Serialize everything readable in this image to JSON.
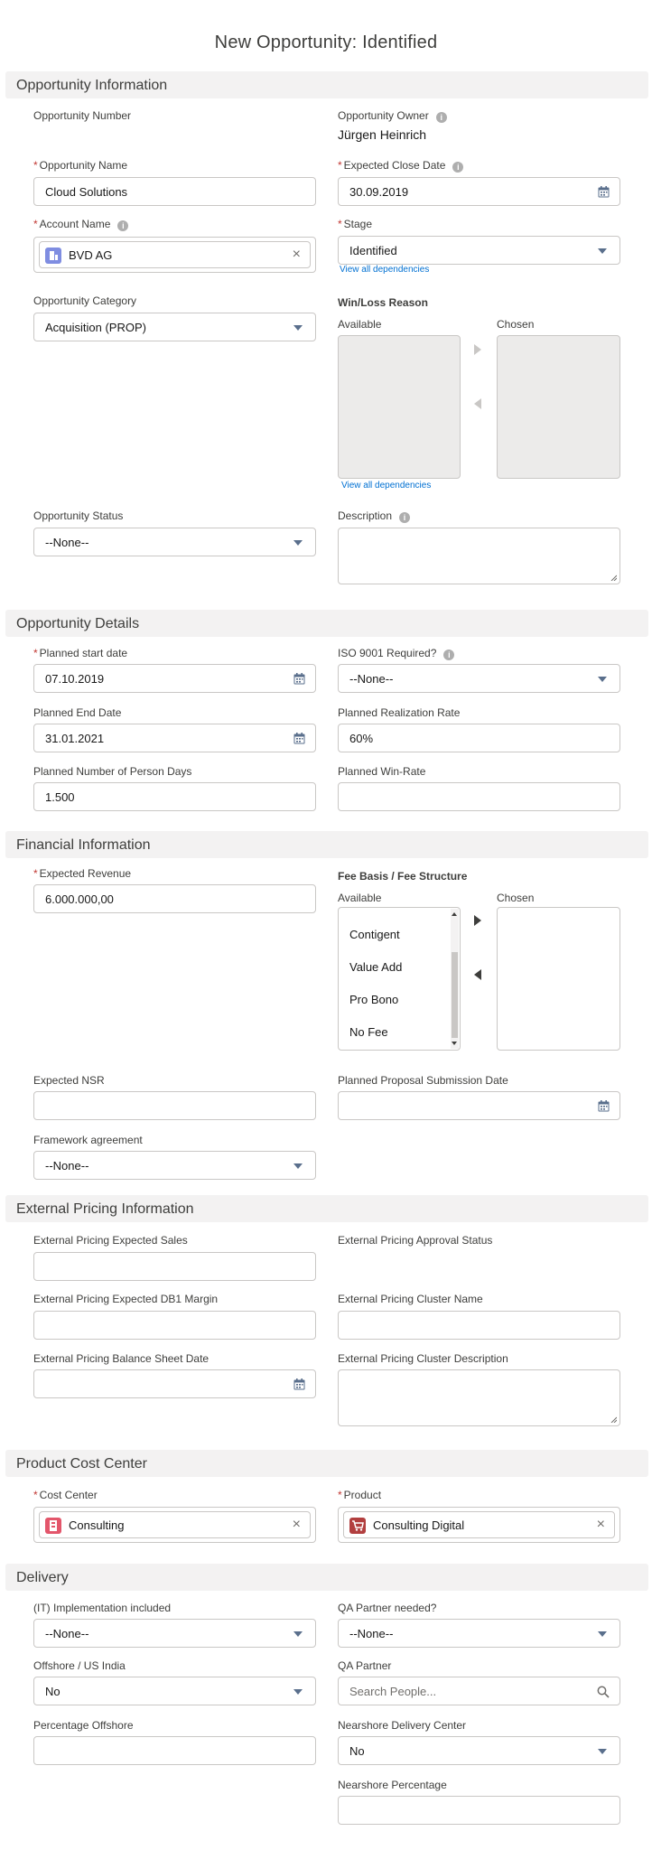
{
  "title": "New Opportunity: Identified",
  "sections": {
    "info": "Opportunity Information",
    "details": "Opportunity Details",
    "financial": "Financial Information",
    "external": "External Pricing Information",
    "cost": "Product Cost Center",
    "delivery": "Delivery"
  },
  "info": {
    "opp_number_label": "Opportunity Number",
    "opp_owner_label": "Opportunity Owner",
    "opp_owner_value": "Jürgen Heinrich",
    "opp_name_label": "Opportunity Name",
    "opp_name_value": "Cloud Solutions",
    "close_date_label": "Expected Close Date",
    "close_date_value": "30.09.2019",
    "account_label": "Account Name",
    "account_value": "BVD AG",
    "stage_label": "Stage",
    "stage_value": "Identified",
    "view_deps": "View all dependencies",
    "category_label": "Opportunity Category",
    "category_value": "Acquisition (PROP)",
    "winloss_label": "Win/Loss Reason",
    "available_label": "Available",
    "chosen_label": "Chosen",
    "status_label": "Opportunity Status",
    "status_value": "--None--",
    "description_label": "Description"
  },
  "details": {
    "start_label": "Planned start date",
    "start_value": "07.10.2019",
    "iso_label": "ISO 9001 Required?",
    "iso_value": "--None--",
    "end_label": "Planned End Date",
    "end_value": "31.01.2021",
    "realization_label": "Planned Realization Rate",
    "realization_value": "60%",
    "persondays_label": "Planned Number of Person Days",
    "persondays_value": "1.500",
    "winrate_label": "Planned Win-Rate"
  },
  "financial": {
    "revenue_label": "Expected Revenue",
    "revenue_value": "6.000.000,00",
    "fee_label": "Fee Basis / Fee Structure",
    "available_label": "Available",
    "chosen_label": "Chosen",
    "fee_options": [
      "Contigent",
      "Value Add",
      "Pro Bono",
      "No Fee"
    ],
    "nsr_label": "Expected NSR",
    "proposal_date_label": "Planned Proposal Submission Date",
    "framework_label": "Framework agreement",
    "framework_value": "--None--"
  },
  "external": {
    "sales_label": "External Pricing Expected Sales",
    "approval_label": "External Pricing Approval Status",
    "db1_label": "External Pricing Expected DB1 Margin",
    "cluster_name_label": "External Pricing Cluster Name",
    "balance_label": "External Pricing Balance Sheet Date",
    "cluster_desc_label": "External Pricing Cluster Description"
  },
  "cost": {
    "cost_center_label": "Cost Center",
    "cost_center_value": "Consulting",
    "product_label": "Product",
    "product_value": "Consulting Digital"
  },
  "delivery": {
    "impl_label": "(IT) Implementation included",
    "impl_value": "--None--",
    "qa_needed_label": "QA Partner needed?",
    "qa_needed_value": "--None--",
    "offshore_label": "Offshore / US India",
    "offshore_value": "No",
    "qa_partner_label": "QA Partner",
    "qa_partner_placeholder": "Search People...",
    "pct_offshore_label": "Percentage Offshore",
    "nearshore_center_label": "Nearshore Delivery Center",
    "nearshore_center_value": "No",
    "nearshore_pct_label": "Nearshore Percentage"
  },
  "colors": {
    "required": "#c23934",
    "link": "#0070d2",
    "section_bg": "#f3f2f2",
    "account_icon": "#7f8de1",
    "cost_center_icon": "#e3566b",
    "product_icon": "#b23f3f"
  },
  "icons": [
    "info-icon",
    "calendar-icon",
    "dropdown-caret-icon",
    "clear-icon",
    "account-icon",
    "cost-center-icon",
    "product-icon",
    "search-icon",
    "move-right-icon",
    "move-left-icon"
  ]
}
